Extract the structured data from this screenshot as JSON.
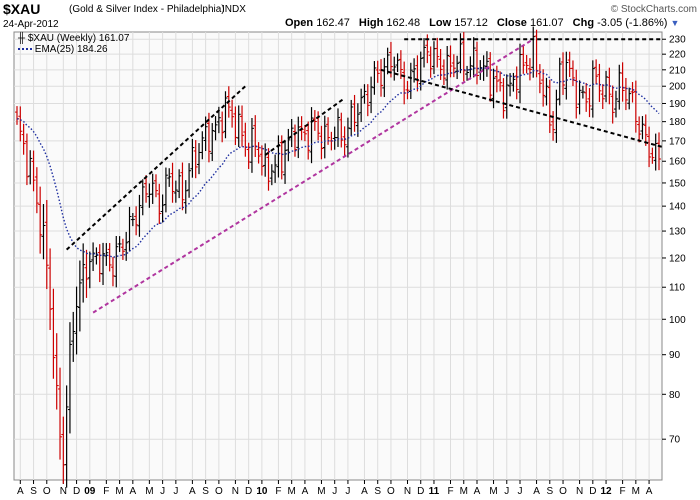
{
  "header": {
    "symbol": "$XAU",
    "subtitle": "(Gold & Silver Index - Philadelphia)",
    "exchange": "INDX",
    "date": "24-Apr-2012",
    "brand": "© StockCharts.com",
    "quote": {
      "open_label": "Open",
      "open": "162.47",
      "high_label": "High",
      "high": "162.48",
      "low_label": "Low",
      "low": "157.12",
      "close_label": "Close",
      "close": "161.07",
      "chg_label": "Chg",
      "chg": "-3.05 (-1.86%)"
    }
  },
  "legend": {
    "price": "$XAU (Weekly) 161.07",
    "ema": "EMA(25) 184.26"
  },
  "colors": {
    "up": "#000000",
    "down": "#cc0000",
    "ema": "#1f2fa0",
    "trend_black": "#000000",
    "trend_purple": "#b0359f",
    "grid": "#dddddd",
    "plot_bg": "#fafafa"
  },
  "chart_data": {
    "type": "ohlc",
    "scale": "log",
    "ylim": [
      62,
      235
    ],
    "y_ticks": [
      70,
      80,
      90,
      100,
      110,
      120,
      130,
      140,
      150,
      160,
      170,
      180,
      190,
      200,
      210,
      220,
      230
    ],
    "x_labels": [
      {
        "label": "A",
        "week": 1
      },
      {
        "label": "S",
        "week": 5
      },
      {
        "label": "O",
        "week": 9
      },
      {
        "label": "N",
        "week": 14
      },
      {
        "label": "D",
        "week": 18
      },
      {
        "label": "09",
        "week": 22,
        "year": true
      },
      {
        "label": "F",
        "week": 27
      },
      {
        "label": "M",
        "week": 31
      },
      {
        "label": "A",
        "week": 35
      },
      {
        "label": "M",
        "week": 40
      },
      {
        "label": "J",
        "week": 44
      },
      {
        "label": "J",
        "week": 48
      },
      {
        "label": "A",
        "week": 53
      },
      {
        "label": "S",
        "week": 57
      },
      {
        "label": "O",
        "week": 61
      },
      {
        "label": "N",
        "week": 66
      },
      {
        "label": "D",
        "week": 70
      },
      {
        "label": "10",
        "week": 74,
        "year": true
      },
      {
        "label": "F",
        "week": 79
      },
      {
        "label": "M",
        "week": 83
      },
      {
        "label": "A",
        "week": 87
      },
      {
        "label": "M",
        "week": 92
      },
      {
        "label": "J",
        "week": 96
      },
      {
        "label": "J",
        "week": 100
      },
      {
        "label": "A",
        "week": 105
      },
      {
        "label": "S",
        "week": 109
      },
      {
        "label": "O",
        "week": 113
      },
      {
        "label": "N",
        "week": 118
      },
      {
        "label": "D",
        "week": 122
      },
      {
        "label": "11",
        "week": 126,
        "year": true
      },
      {
        "label": "F",
        "week": 131
      },
      {
        "label": "M",
        "week": 135
      },
      {
        "label": "A",
        "week": 139
      },
      {
        "label": "M",
        "week": 144
      },
      {
        "label": "J",
        "week": 148
      },
      {
        "label": "J",
        "week": 152
      },
      {
        "label": "A",
        "week": 157
      },
      {
        "label": "S",
        "week": 161
      },
      {
        "label": "O",
        "week": 165
      },
      {
        "label": "N",
        "week": 170
      },
      {
        "label": "D",
        "week": 174
      },
      {
        "label": "12",
        "week": 178,
        "year": true
      },
      {
        "label": "F",
        "week": 183
      },
      {
        "label": "M",
        "week": 187
      },
      {
        "label": "A",
        "week": 191
      }
    ],
    "close_anchors": [
      [
        0,
        178
      ],
      [
        5,
        150
      ],
      [
        9,
        118
      ],
      [
        12,
        78
      ],
      [
        14,
        66
      ],
      [
        17,
        100
      ],
      [
        19,
        110
      ],
      [
        21,
        118
      ],
      [
        25,
        120
      ],
      [
        29,
        118
      ],
      [
        33,
        128
      ],
      [
        37,
        140
      ],
      [
        40,
        150
      ],
      [
        43,
        140
      ],
      [
        46,
        152
      ],
      [
        50,
        145
      ],
      [
        53,
        160
      ],
      [
        57,
        172
      ],
      [
        60,
        175
      ],
      [
        63,
        188
      ],
      [
        66,
        180
      ],
      [
        70,
        165
      ],
      [
        72,
        170
      ],
      [
        75,
        155
      ],
      [
        78,
        158
      ],
      [
        81,
        165
      ],
      [
        84,
        175
      ],
      [
        87,
        172
      ],
      [
        90,
        178
      ],
      [
        93,
        170
      ],
      [
        96,
        175
      ],
      [
        99,
        172
      ],
      [
        102,
        185
      ],
      [
        105,
        192
      ],
      [
        108,
        205
      ],
      [
        111,
        210
      ],
      [
        114,
        218
      ],
      [
        116,
        205
      ],
      [
        118,
        200
      ],
      [
        121,
        212
      ],
      [
        124,
        222
      ],
      [
        127,
        215
      ],
      [
        130,
        210
      ],
      [
        133,
        218
      ],
      [
        136,
        212
      ],
      [
        139,
        215
      ],
      [
        142,
        208
      ],
      [
        145,
        200
      ],
      [
        148,
        195
      ],
      [
        151,
        208
      ],
      [
        154,
        215
      ],
      [
        156,
        220
      ],
      [
        158,
        205
      ],
      [
        160,
        190
      ],
      [
        162,
        178
      ],
      [
        164,
        205
      ],
      [
        166,
        215
      ],
      [
        168,
        200
      ],
      [
        170,
        195
      ],
      [
        172,
        190
      ],
      [
        174,
        205
      ],
      [
        176,
        200
      ],
      [
        178,
        198
      ],
      [
        180,
        190
      ],
      [
        182,
        200
      ],
      [
        184,
        198
      ],
      [
        186,
        190
      ],
      [
        188,
        178
      ],
      [
        190,
        170
      ],
      [
        192,
        164
      ],
      [
        194,
        161.07
      ]
    ],
    "weeks": 195,
    "ema_period": 25,
    "trendlines": [
      {
        "color": "black",
        "from": [
          15,
          123
        ],
        "to": [
          69,
          200
        ]
      },
      {
        "color": "black",
        "from": [
          75,
          163
        ],
        "to": [
          99,
          193
        ]
      },
      {
        "color": "purple",
        "from": [
          23,
          102
        ],
        "to": [
          156,
          230
        ]
      },
      {
        "color": "black",
        "from": [
          117,
          230
        ],
        "to": [
          195,
          230
        ]
      },
      {
        "color": "black",
        "from": [
          110,
          210
        ],
        "to": [
          195,
          167
        ]
      }
    ]
  }
}
